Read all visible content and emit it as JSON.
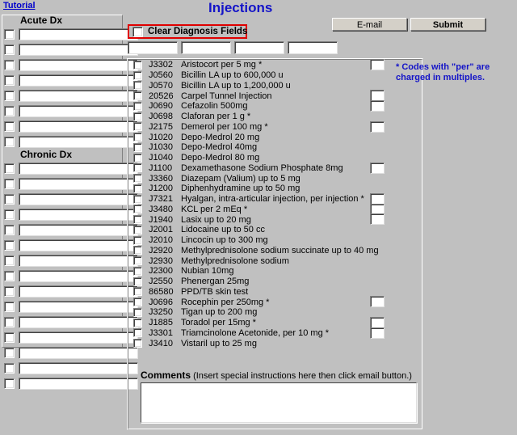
{
  "header": {
    "tutorial_link": "Tutorial",
    "title": "Injections",
    "email_button": "E-mail",
    "submit_button": "Submit"
  },
  "clear_dx": {
    "label": "Clear Diagnosis Fields",
    "checked": false
  },
  "code_fields": [
    {
      "value": "",
      "placeholder": ""
    },
    {
      "value": "",
      "placeholder": ""
    },
    {
      "value": "",
      "placeholder": ""
    },
    {
      "value": "",
      "placeholder": ""
    }
  ],
  "diagnosis": {
    "acute_heading": "Acute Dx",
    "chronic_heading": "Chronic Dx",
    "acute_rows": [
      {
        "value": "",
        "checked": false
      },
      {
        "value": "",
        "checked": false
      },
      {
        "value": "",
        "checked": false
      },
      {
        "value": "",
        "checked": false
      },
      {
        "value": "",
        "checked": false
      },
      {
        "value": "",
        "checked": false
      },
      {
        "value": "",
        "checked": false
      },
      {
        "value": "",
        "checked": false
      }
    ],
    "chronic_rows": [
      {
        "value": "",
        "checked": false
      },
      {
        "value": "",
        "checked": false
      },
      {
        "value": "",
        "checked": false
      },
      {
        "value": "",
        "checked": false
      },
      {
        "value": "",
        "checked": false
      },
      {
        "value": "",
        "checked": false
      },
      {
        "value": "",
        "checked": false
      },
      {
        "value": "",
        "checked": false
      },
      {
        "value": "",
        "checked": false
      },
      {
        "value": "",
        "checked": false
      },
      {
        "value": "",
        "checked": false
      },
      {
        "value": "",
        "checked": false
      },
      {
        "value": "",
        "checked": false
      },
      {
        "value": "",
        "checked": false
      },
      {
        "value": "",
        "checked": false
      }
    ]
  },
  "drugs": [
    {
      "code": "J3302",
      "name": "Aristocort per 5 mg  *",
      "qty": true,
      "qty_value": "",
      "checked": false
    },
    {
      "code": "J0560",
      "name": "Bicillin LA up to 600,000 u",
      "qty": false,
      "qty_value": "",
      "checked": false
    },
    {
      "code": "J0570",
      "name": "Bicillin LA up to 1,200,000 u",
      "qty": false,
      "qty_value": "",
      "checked": false
    },
    {
      "code": "20526",
      "name": "Carpel Tunnel Injection",
      "qty": true,
      "qty_value": "",
      "checked": false
    },
    {
      "code": "J0690",
      "name": "Cefazolin 500mg",
      "qty": true,
      "qty_value": "",
      "checked": false
    },
    {
      "code": "J0698",
      "name": "Claforan per 1 g  *",
      "qty": false,
      "qty_value": "",
      "checked": false
    },
    {
      "code": "J2175",
      "name": "Demerol per 100 mg  *",
      "qty": true,
      "qty_value": "",
      "checked": false
    },
    {
      "code": "J1020",
      "name": "Depo-Medrol 20 mg",
      "qty": false,
      "qty_value": "",
      "checked": false
    },
    {
      "code": "J1030",
      "name": "Depo-Medrol 40mg",
      "qty": false,
      "qty_value": "",
      "checked": false
    },
    {
      "code": "J1040",
      "name": "Depo-Medrol 80 mg",
      "qty": false,
      "qty_value": "",
      "checked": false
    },
    {
      "code": "J1100",
      "name": "Dexamethasone Sodium Phosphate 8mg",
      "qty": true,
      "qty_value": "",
      "checked": false
    },
    {
      "code": "J3360",
      "name": "Diazepam (Valium) up to 5 mg",
      "qty": false,
      "qty_value": "",
      "checked": false
    },
    {
      "code": "J1200",
      "name": "Diphenhydramine up to 50 mg",
      "qty": false,
      "qty_value": "",
      "checked": false
    },
    {
      "code": "J7321",
      "name": "Hyalgan, intra-articular injection, per injection  *",
      "qty": true,
      "qty_value": "",
      "checked": false
    },
    {
      "code": "J3480",
      "name": "KCL per 2 mEq  *",
      "qty": true,
      "qty_value": "",
      "checked": false
    },
    {
      "code": "J1940",
      "name": "Lasix up to 20 mg",
      "qty": true,
      "qty_value": "",
      "checked": false
    },
    {
      "code": "J2001",
      "name": "Lidocaine up to 50 cc",
      "qty": false,
      "qty_value": "",
      "checked": false
    },
    {
      "code": "J2010",
      "name": "Lincocin up to 300 mg",
      "qty": false,
      "qty_value": "",
      "checked": false
    },
    {
      "code": "J2920",
      "name": "Methylprednisolone sodium succinate up to 40 mg",
      "qty": false,
      "qty_value": "",
      "checked": false
    },
    {
      "code": "J2930",
      "name": "Methylprednisolone sodium",
      "qty": false,
      "qty_value": "",
      "checked": false
    },
    {
      "code": "J2300",
      "name": "Nubian 10mg",
      "qty": false,
      "qty_value": "",
      "checked": false
    },
    {
      "code": "J2550",
      "name": "Phenergan 25mg",
      "qty": false,
      "qty_value": "",
      "checked": false
    },
    {
      "code": "86580",
      "name": "PPD/TB skin test",
      "qty": false,
      "qty_value": "",
      "checked": false
    },
    {
      "code": "J0696",
      "name": "Rocephin per 250mg  *",
      "qty": true,
      "qty_value": "",
      "checked": false
    },
    {
      "code": "J3250",
      "name": "Tigan up to 200 mg",
      "qty": false,
      "qty_value": "",
      "checked": false
    },
    {
      "code": "J1885",
      "name": "Toradol per 15mg *",
      "qty": true,
      "qty_value": "",
      "checked": false
    },
    {
      "code": "J3301",
      "name": "Triamcinolone Acetonide, per 10 mg *",
      "qty": true,
      "qty_value": "",
      "checked": false
    },
    {
      "code": "J3410",
      "name": "Vistaril up to 25 mg",
      "qty": false,
      "qty_value": "",
      "checked": false
    }
  ],
  "note": {
    "line1": "*  Codes with \"per\" are",
    "line2": "charged in multiples."
  },
  "comments": {
    "label": "Comments",
    "hint": " (Insert special instructions here then click email button.)",
    "value": "",
    "placeholder": ""
  },
  "colors": {
    "title_blue": "#1414c8",
    "link_blue": "#0000cc",
    "highlight_red": "#e00000",
    "window_gray": "#c0c0c0",
    "button_face": "#d4d0c8"
  }
}
